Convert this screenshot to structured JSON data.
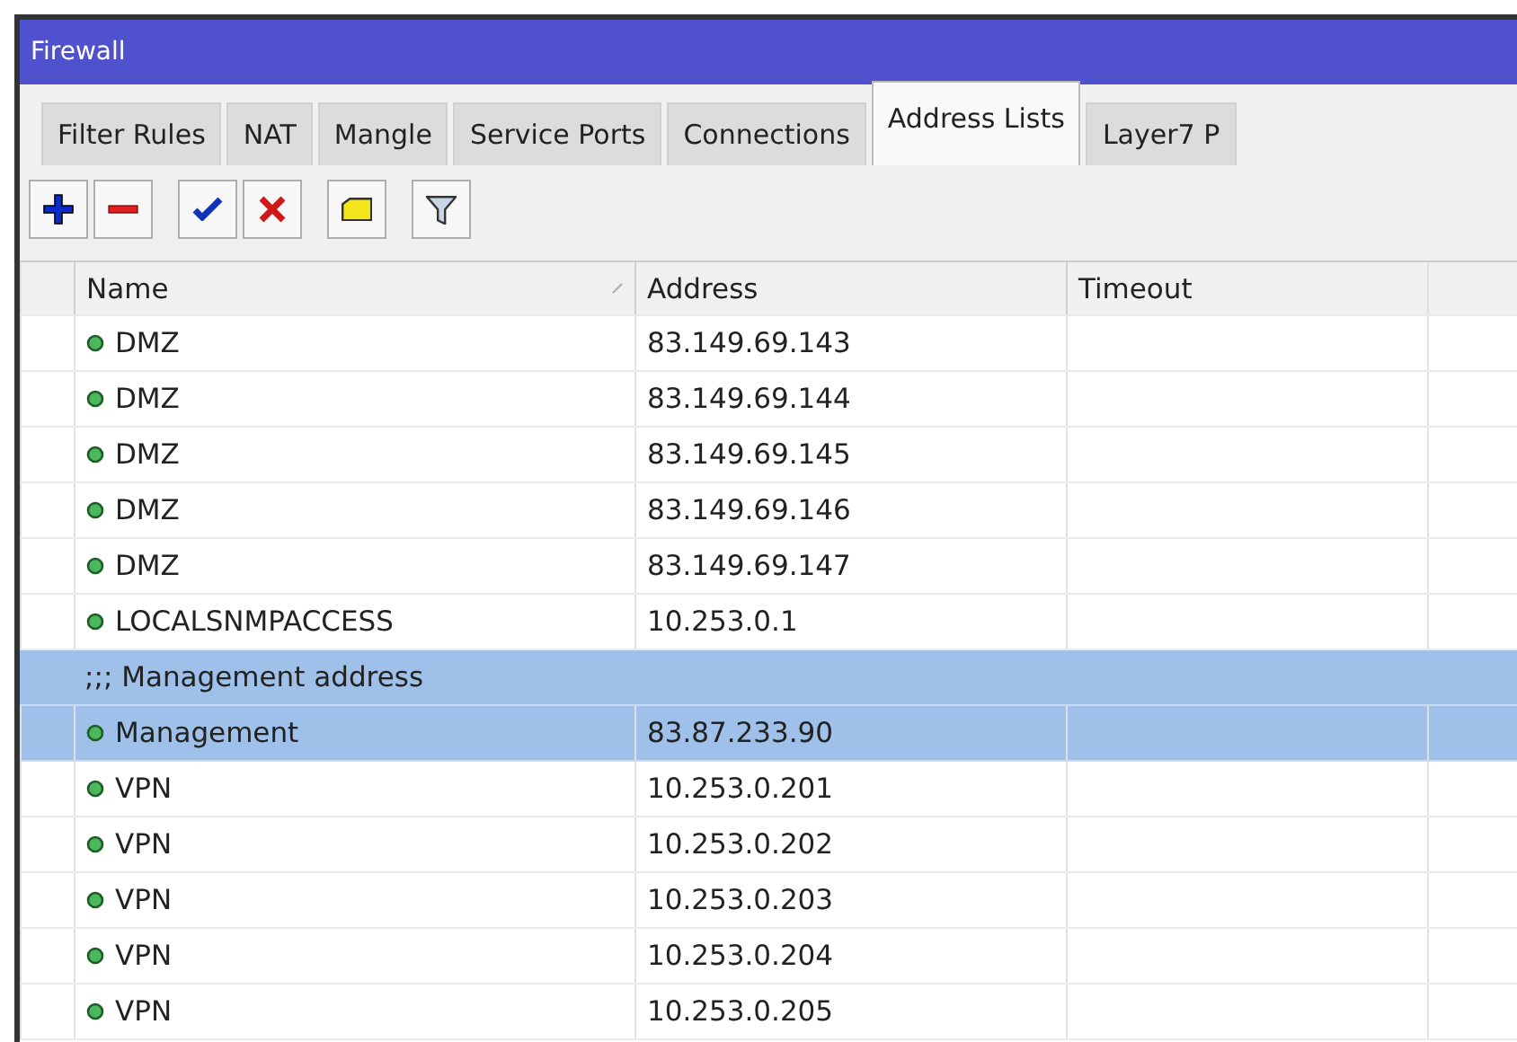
{
  "window": {
    "title": "Firewall"
  },
  "tabs": [
    {
      "label": "Filter Rules",
      "selected": false
    },
    {
      "label": "NAT",
      "selected": false
    },
    {
      "label": "Mangle",
      "selected": false
    },
    {
      "label": "Service Ports",
      "selected": false
    },
    {
      "label": "Connections",
      "selected": false
    },
    {
      "label": "Address Lists",
      "selected": true
    },
    {
      "label": "Layer7 P",
      "selected": false
    }
  ],
  "toolbar": [
    [
      {
        "kind": "add"
      },
      {
        "kind": "remove"
      }
    ],
    [
      {
        "kind": "enable"
      },
      {
        "kind": "disable"
      }
    ],
    [
      {
        "kind": "comment"
      }
    ],
    [
      {
        "kind": "filter"
      }
    ]
  ],
  "table": {
    "columns": [
      "Name",
      "Address",
      "Timeout"
    ],
    "rows": [
      {
        "kind": "entry",
        "name": "DMZ",
        "address": "83.149.69.143",
        "selected": false
      },
      {
        "kind": "entry",
        "name": "DMZ",
        "address": "83.149.69.144",
        "selected": false
      },
      {
        "kind": "entry",
        "name": "DMZ",
        "address": "83.149.69.145",
        "selected": false
      },
      {
        "kind": "entry",
        "name": "DMZ",
        "address": "83.149.69.146",
        "selected": false
      },
      {
        "kind": "entry",
        "name": "DMZ",
        "address": "83.149.69.147",
        "selected": false
      },
      {
        "kind": "entry",
        "name": "LOCALSNMPACCESS",
        "address": "10.253.0.1",
        "selected": false
      },
      {
        "kind": "comment",
        "text": ";;; Management address",
        "selected": true
      },
      {
        "kind": "entry",
        "name": "Management",
        "address": "83.87.233.90",
        "selected": true
      },
      {
        "kind": "entry",
        "name": "VPN",
        "address": "10.253.0.201",
        "selected": false
      },
      {
        "kind": "entry",
        "name": "VPN",
        "address": "10.253.0.202",
        "selected": false
      },
      {
        "kind": "entry",
        "name": "VPN",
        "address": "10.253.0.203",
        "selected": false
      },
      {
        "kind": "entry",
        "name": "VPN",
        "address": "10.253.0.204",
        "selected": false
      },
      {
        "kind": "entry",
        "name": "VPN",
        "address": "10.253.0.205",
        "selected": false
      }
    ]
  }
}
